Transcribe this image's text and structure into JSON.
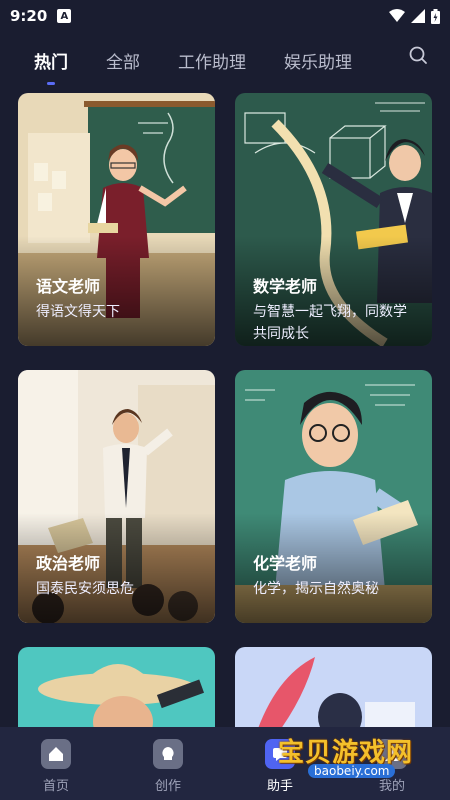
{
  "status": {
    "time": "9:20",
    "notif_glyph": "A"
  },
  "tabs": [
    {
      "label": "热门"
    },
    {
      "label": "全部"
    },
    {
      "label": "工作助理"
    },
    {
      "label": "娱乐助理"
    }
  ],
  "active_tab": "热门",
  "cards": [
    {
      "title": "语文老师",
      "desc": "得语文得天下"
    },
    {
      "title": "数学老师",
      "desc": "与智慧一起飞翔，同数学共同成长"
    },
    {
      "title": "政治老师",
      "desc": "国泰民安须思危"
    },
    {
      "title": "化学老师",
      "desc": "化学，揭示自然奥秘"
    }
  ],
  "nav": [
    {
      "label": "首页",
      "icon": "home-icon"
    },
    {
      "label": "创作",
      "icon": "bulb-icon"
    },
    {
      "label": "助手",
      "icon": "chat-icon"
    },
    {
      "label": "我的",
      "icon": "user-icon"
    }
  ],
  "watermark": {
    "text": "宝贝游戏网",
    "url": "baobeiy.com"
  },
  "colors": {
    "background": "#1a1d30",
    "accent": "#5a6cf5",
    "nav_bg": "#222640"
  }
}
